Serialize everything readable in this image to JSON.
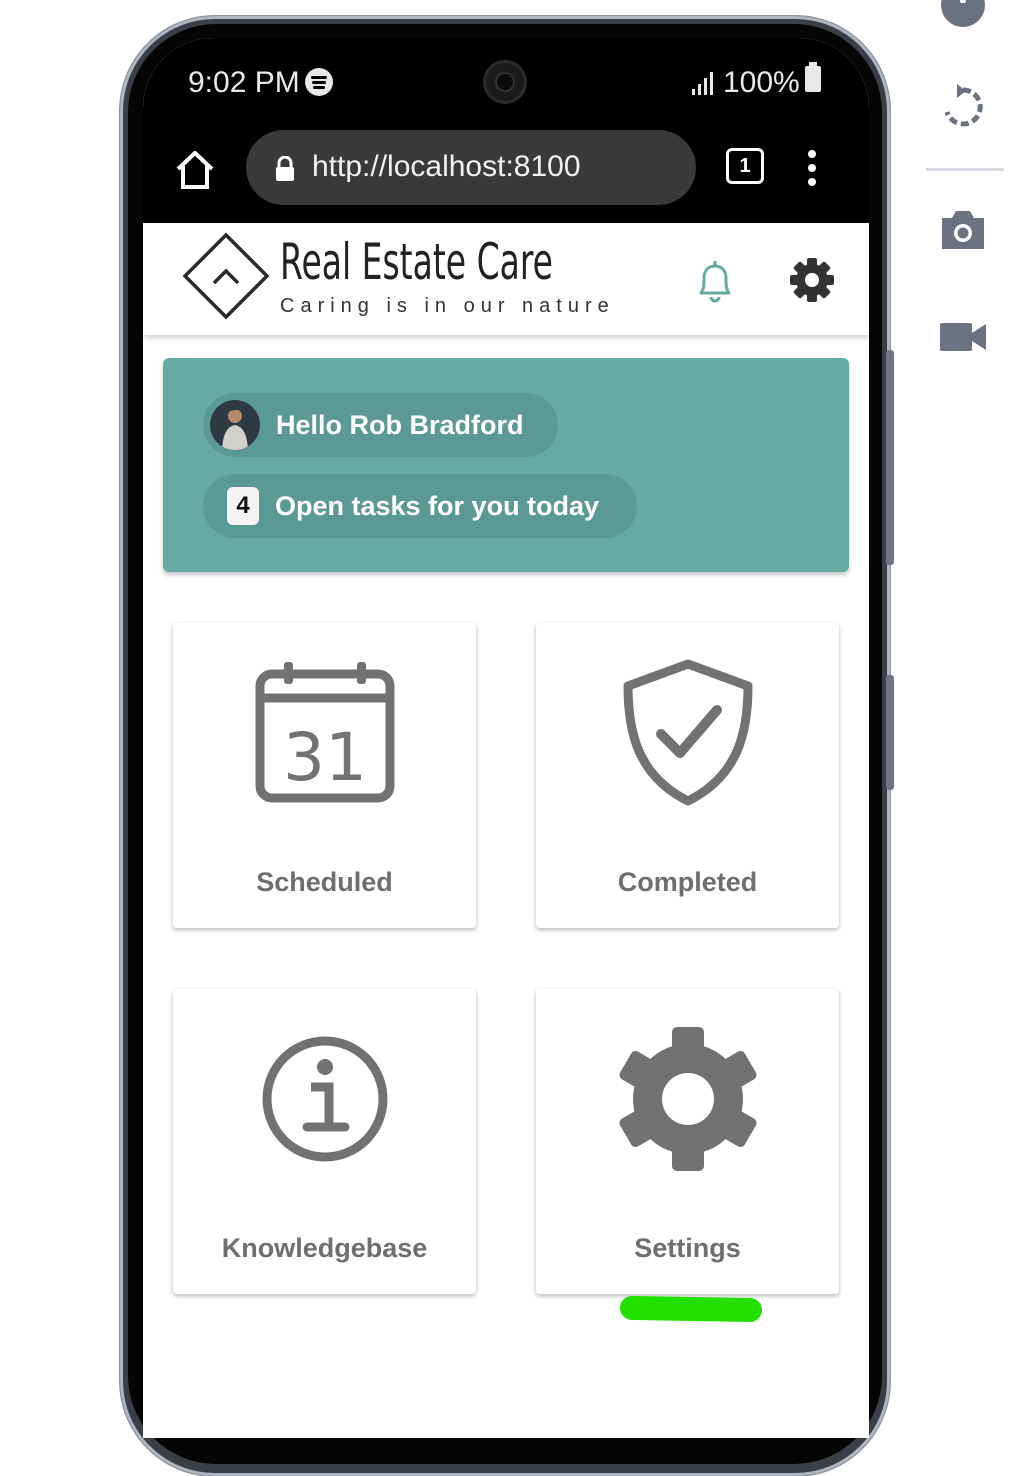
{
  "status_bar": {
    "time": "9:02 PM",
    "battery": "100%"
  },
  "browser": {
    "url": "http://localhost:8100",
    "tab_count": "1"
  },
  "header": {
    "brand": "Real Estate Care",
    "tagline": "Caring is in our nature"
  },
  "greeting": {
    "hello": "Hello Rob Bradford",
    "task_count": "4",
    "tasks_text": "Open tasks for you today"
  },
  "calendar_day": "31",
  "tiles": [
    {
      "label": "Scheduled",
      "icon": "calendar-icon"
    },
    {
      "label": "Completed",
      "icon": "shield-check-icon"
    },
    {
      "label": "Knowledgebase",
      "icon": "info-icon"
    },
    {
      "label": "Settings",
      "icon": "gear-icon"
    }
  ],
  "colors": {
    "teal": "#67aaa3",
    "icon_grey": "#727272",
    "highlight": "#22e000"
  }
}
